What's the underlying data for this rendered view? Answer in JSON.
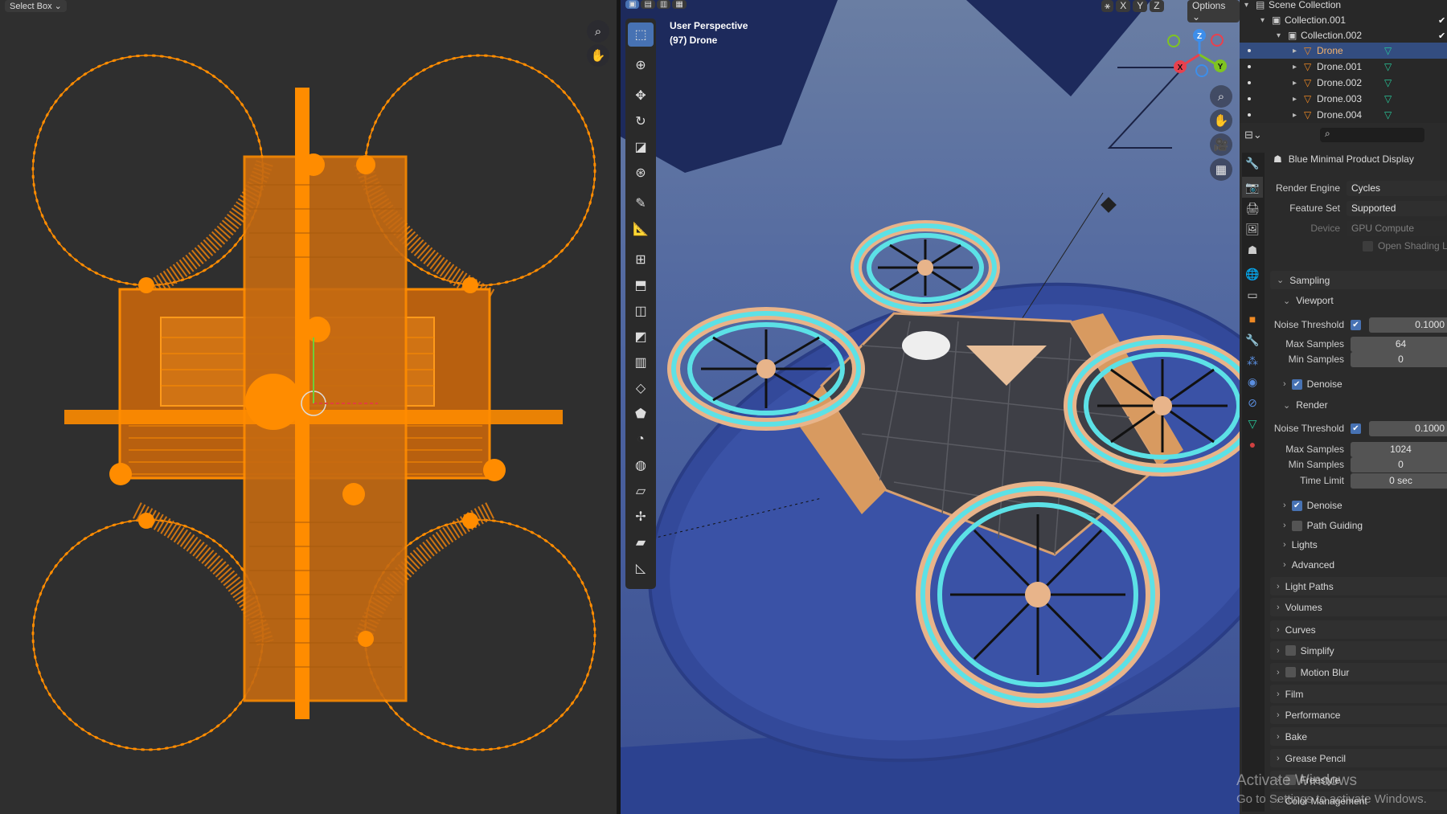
{
  "uv_editor": {
    "select_mode": "Select Box ⌄",
    "icons": [
      "zoom-icon",
      "hand-icon"
    ],
    "mesh_color": "#ff8c00"
  },
  "viewport": {
    "header_axes": [
      "X",
      "Y",
      "Z"
    ],
    "options_label": "Options ⌄",
    "view_name": "User Perspective",
    "object_label": "(97) Drone",
    "gizmo": {
      "x": "X",
      "y": "Y",
      "z": "Z"
    },
    "nav_icons": [
      "zoom-icon",
      "hand-icon",
      "camera-icon",
      "grid-icon"
    ],
    "tools": [
      {
        "name": "select-box",
        "glyph": "⬚",
        "active": true
      },
      {
        "name": "cursor",
        "glyph": "⊕"
      },
      {
        "name": "move",
        "glyph": "✥"
      },
      {
        "name": "rotate",
        "glyph": "↻"
      },
      {
        "name": "scale",
        "glyph": "◪"
      },
      {
        "name": "transform",
        "glyph": "⊛"
      },
      {
        "name": "annotate",
        "glyph": "✎"
      },
      {
        "name": "measure",
        "glyph": "📐"
      },
      {
        "name": "add-cube",
        "glyph": "⊞"
      },
      {
        "name": "extrude",
        "glyph": "⬒"
      },
      {
        "name": "inset",
        "glyph": "◫"
      },
      {
        "name": "bevel",
        "glyph": "◩"
      },
      {
        "name": "loop-cut",
        "glyph": "▥"
      },
      {
        "name": "knife",
        "glyph": "◇"
      },
      {
        "name": "poly-build",
        "glyph": "⬟"
      },
      {
        "name": "spin",
        "glyph": "◔"
      },
      {
        "name": "smooth",
        "glyph": "◍"
      },
      {
        "name": "edge-slide",
        "glyph": "▱"
      },
      {
        "name": "shrink-fatten",
        "glyph": "✢"
      },
      {
        "name": "shear",
        "glyph": "▰"
      },
      {
        "name": "rip",
        "glyph": "◺"
      }
    ],
    "accent": "#4772b3",
    "wire_color": "#5ce1e6"
  },
  "outliner": {
    "rows": [
      {
        "label": "Scene Collection",
        "type": "scene",
        "indent": 0
      },
      {
        "label": "Collection.001",
        "type": "collection",
        "indent": 1,
        "checked": true
      },
      {
        "label": "Collection.002",
        "type": "collection",
        "indent": 2,
        "checked": true
      },
      {
        "label": "Drone",
        "type": "object",
        "indent": 3,
        "selected": true
      },
      {
        "label": "Drone.001",
        "type": "object",
        "indent": 3
      },
      {
        "label": "Drone.002",
        "type": "object",
        "indent": 3
      },
      {
        "label": "Drone.003",
        "type": "object",
        "indent": 3
      },
      {
        "label": "Drone.004",
        "type": "object",
        "indent": 3
      }
    ]
  },
  "properties": {
    "scene_name": "Blue Minimal Product Display",
    "search_placeholder": "",
    "tabs": [
      "tool",
      "render",
      "output",
      "view-layer",
      "scene",
      "world",
      "collection",
      "object",
      "modifier",
      "particles",
      "physics",
      "constraints",
      "data",
      "material"
    ],
    "render_engine": {
      "label": "Render Engine",
      "value": "Cycles"
    },
    "feature_set": {
      "label": "Feature Set",
      "value": "Supported"
    },
    "device": {
      "label": "Device",
      "value": "GPU Compute"
    },
    "open_shading": {
      "label": "Open Shading Lan",
      "checked": false
    },
    "rows": [
      {
        "kind": "panel",
        "label": "Sampling",
        "open": true
      },
      {
        "kind": "sub",
        "label": "Viewport",
        "open": true
      },
      {
        "kind": "field",
        "label": "Noise Threshold",
        "value": "0.1000",
        "checked": true
      },
      {
        "kind": "field",
        "label": "Max Samples",
        "value": "64"
      },
      {
        "kind": "field",
        "label": "Min Samples",
        "value": "0"
      },
      {
        "kind": "sub",
        "label": "Denoise",
        "checked": true
      },
      {
        "kind": "sub",
        "label": "Render",
        "open": true
      },
      {
        "kind": "field",
        "label": "Noise Threshold",
        "value": "0.1000",
        "checked": true
      },
      {
        "kind": "field",
        "label": "Max Samples",
        "value": "1024"
      },
      {
        "kind": "field",
        "label": "Min Samples",
        "value": "0"
      },
      {
        "kind": "field",
        "label": "Time Limit",
        "value": "0 sec"
      },
      {
        "kind": "sub",
        "label": "Denoise",
        "checked": true
      },
      {
        "kind": "sub",
        "label": "Path Guiding",
        "checked": false
      },
      {
        "kind": "sub",
        "label": "Lights"
      },
      {
        "kind": "sub",
        "label": "Advanced"
      },
      {
        "kind": "panel",
        "label": "Light Paths"
      },
      {
        "kind": "panel",
        "label": "Volumes"
      },
      {
        "kind": "panel",
        "label": "Curves"
      },
      {
        "kind": "panel",
        "label": "Simplify",
        "checked": false
      },
      {
        "kind": "panel",
        "label": "Motion Blur",
        "checked": false
      },
      {
        "kind": "panel",
        "label": "Film"
      },
      {
        "kind": "panel",
        "label": "Performance"
      },
      {
        "kind": "panel",
        "label": "Bake"
      },
      {
        "kind": "panel",
        "label": "Grease Pencil"
      },
      {
        "kind": "panel",
        "label": "Freestyle",
        "checked": false
      },
      {
        "kind": "panel",
        "label": "Color Management"
      }
    ]
  },
  "watermark": {
    "line1": "Activate Windows",
    "line2": "Go to Settings to activate Windows."
  }
}
